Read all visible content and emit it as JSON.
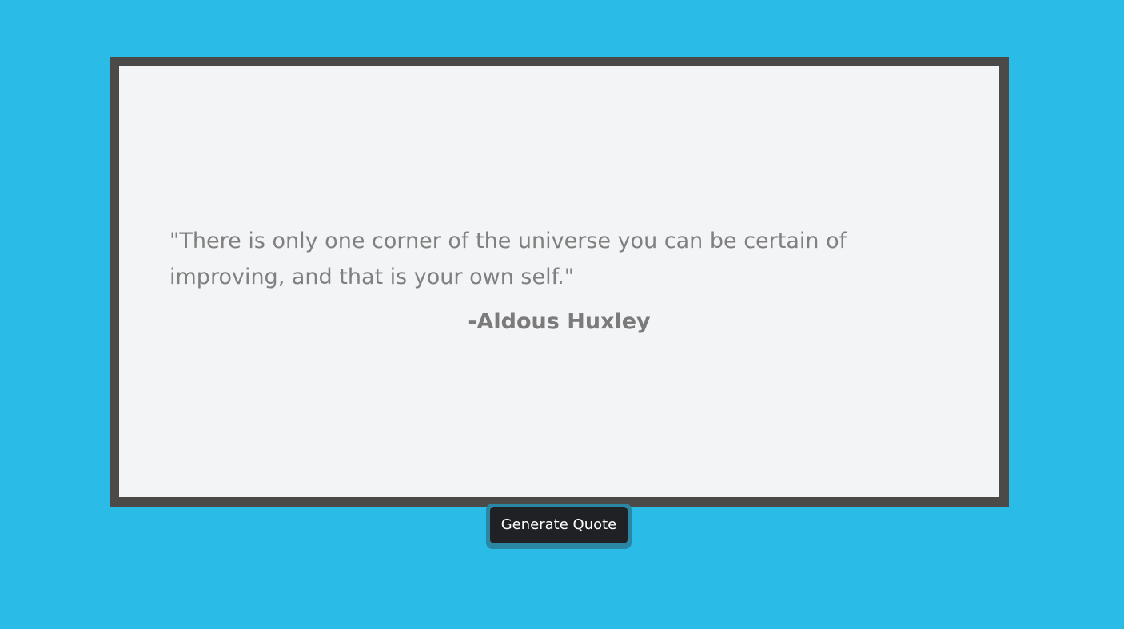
{
  "quote": {
    "text": "\"There is only one corner of the universe you can be certain of improving, and that is your own self.\"",
    "author": "-Aldous Huxley"
  },
  "controls": {
    "generate_label": "Generate Quote"
  },
  "colors": {
    "background": "#2bbbe7",
    "frame_border": "#4b4a48",
    "card_background": "#f3f4f6",
    "text": "#808080",
    "button": "#1f2124",
    "button_outline": "#2a86a3"
  }
}
